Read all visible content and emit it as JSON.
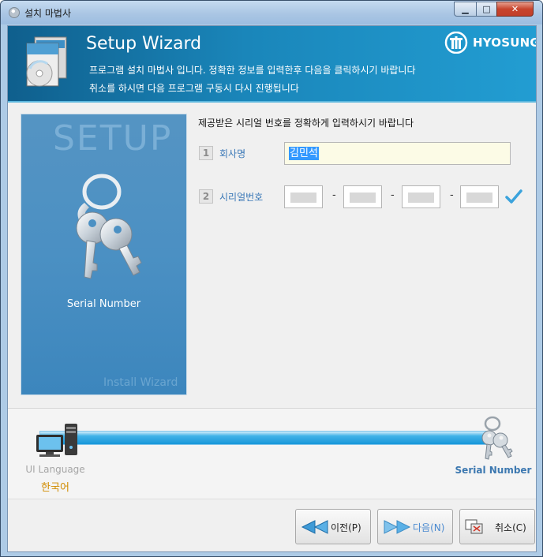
{
  "window": {
    "title": "설치 마법사",
    "minimize_glyph": "▁",
    "maximize_glyph": "□",
    "close_glyph": "✕"
  },
  "banner": {
    "title": "Setup Wizard",
    "line1": "프로그램 설치 마법사 입니다. 정확한 정보를 입력한후 다음을 클릭하시기 바랍니다",
    "line2": "취소를 하시면 다음 프로그램 구동시 다시 진행됩니다",
    "logo_text": "HYOSUNG"
  },
  "side_panel": {
    "watermark": "SETUP",
    "label": "Serial Number",
    "footer": "Install Wizard"
  },
  "form": {
    "instruction": "제공받은 시리얼 번호를 정확하게 입력하시기 바랍니다",
    "company_step": "1",
    "company_label": "회사명",
    "company_value": "김민석",
    "serial_step": "2",
    "serial_label": "시리얼번호",
    "serial_separator": "-"
  },
  "steps": [
    {
      "label": "UI Language",
      "value": "한국어"
    },
    {
      "label": "Serial Number"
    }
  ],
  "buttons": {
    "prev": "이전(P)",
    "next": "다음(N)",
    "cancel": "취소(C)"
  },
  "colors": {
    "accent": "#1a86ba",
    "label_blue": "#3a78b7",
    "language_value": "#d18c00"
  }
}
